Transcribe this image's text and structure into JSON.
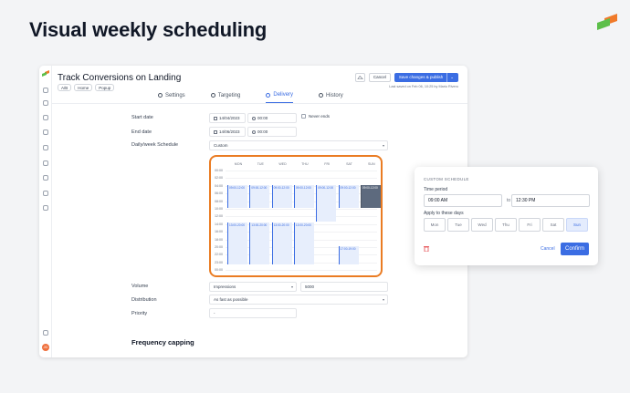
{
  "hero": {
    "title": "Visual weekly scheduling"
  },
  "colors": {
    "accent": "#3b6de3",
    "highlight": "#ea7c23",
    "logo_orange": "#f07a2a",
    "logo_green": "#5cbf4a"
  },
  "app": {
    "title": "Track Conversions on Landing",
    "meta": {
      "ab": "A/B",
      "home": "Home",
      "popup": "Popup"
    },
    "actions": {
      "cancel": "Cancel",
      "save": "Save changes & publish",
      "save_caret": "⌄"
    },
    "last_saved": "Last saved on Feb 06, 10:25 by Mario Rivero",
    "avatar": "JD",
    "tabs": [
      {
        "label": "Settings",
        "icon": "gear-icon"
      },
      {
        "label": "Targeting",
        "icon": "user-icon"
      },
      {
        "label": "Delivery",
        "icon": "send-icon"
      },
      {
        "label": "History",
        "icon": "clock-icon"
      }
    ]
  },
  "form": {
    "start_date_label": "Start date",
    "start_date": "14/04/2023",
    "start_time": "00:00",
    "never_ends": "Never ends",
    "end_date_label": "End date",
    "end_date": "14/06/2023",
    "end_time": "00:00",
    "schedule_label": "Daily/week Schedule",
    "schedule_value": "Custom",
    "volume_label": "Volume",
    "volume_type": "Impressions",
    "volume_value": "5000",
    "distribution_label": "Distribution",
    "distribution_value": "As fast as possible",
    "priority_label": "Priority",
    "priority_value": "-",
    "frequency_title": "Frequency capping"
  },
  "calendar": {
    "days": [
      "MON",
      "TUE",
      "WED",
      "THU",
      "FRI",
      "SAT",
      "SUN"
    ],
    "hours": [
      "00:00",
      "02:00",
      "04:00",
      "06:00",
      "08:00",
      "10:00",
      "12:00",
      "14:00",
      "16:00",
      "18:00",
      "20:00",
      "22:00",
      "23:00",
      "00:00"
    ],
    "block_label": "09:00-12:00",
    "afternoon_label": "13:00-20:00",
    "sat_evening_label": "17:00-19:00"
  },
  "popover": {
    "title": "CUSTOM SCHEDULE",
    "time_period_label": "Time period",
    "from": "09:00 AM",
    "to_word": "to",
    "to": "12:30 PM",
    "apply_label": "Apply to these days",
    "days": [
      "Mon",
      "Tue",
      "Wed",
      "Thu",
      "Fri",
      "Sat",
      "Sun"
    ],
    "active_day": "Sun",
    "cancel": "Cancel",
    "confirm": "Confirm"
  }
}
